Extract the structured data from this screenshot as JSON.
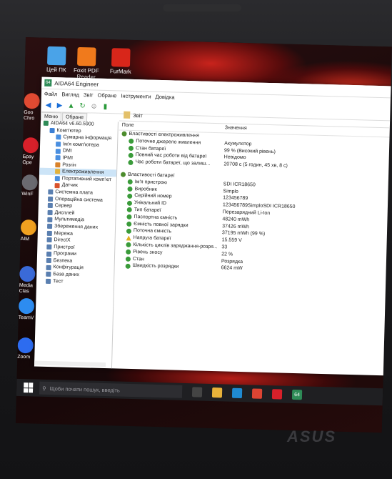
{
  "desktop_icons": [
    {
      "label": "Цей ПК",
      "icon": "computer-icon",
      "color": "#4aa3e8"
    },
    {
      "label": "Foxit PDF Reader",
      "icon": "foxit-pdf-icon",
      "color": "#f07a1c"
    },
    {
      "label": "FurMark",
      "icon": "furmark-icon",
      "color": "#d8261a"
    }
  ],
  "left_edge": [
    {
      "label": "Goo Chro",
      "icon": "chrome-icon"
    },
    {
      "label": "Брау Ope",
      "icon": "opera-icon"
    },
    {
      "label": "WinF",
      "icon": "winf-icon"
    },
    {
      "label": "AIM",
      "icon": "aimp-icon"
    },
    {
      "label": "Media Clas",
      "icon": "media-classic-icon"
    },
    {
      "label": "TeamV",
      "icon": "teamviewer-icon"
    },
    {
      "label": "Zoom",
      "icon": "zoom-icon"
    }
  ],
  "window": {
    "title": "AIDA64 Engineer",
    "menu": [
      "Файл",
      "Вигляд",
      "Звіт",
      "Обране",
      "Інструменти",
      "Довідка"
    ],
    "tabs": [
      "Меню",
      "Обране"
    ],
    "report_button": "Звіт",
    "tree": [
      {
        "label": "AIDA64 v6.60.5900",
        "indent": 0
      },
      {
        "label": "Комп'ютер",
        "indent": 1
      },
      {
        "label": "Сумарна інформація",
        "indent": 2
      },
      {
        "label": "Ім'я комп'ютера",
        "indent": 2
      },
      {
        "label": "DMI",
        "indent": 2
      },
      {
        "label": "IPMI",
        "indent": 2
      },
      {
        "label": "Розгін",
        "indent": 2
      },
      {
        "label": "Електроживлення",
        "indent": 2,
        "selected": true
      },
      {
        "label": "Портативний комп'ют",
        "indent": 2
      },
      {
        "label": "Датчик",
        "indent": 2
      },
      {
        "label": "Системна плата",
        "indent": 1
      },
      {
        "label": "Операційна система",
        "indent": 1
      },
      {
        "label": "Сервер",
        "indent": 1
      },
      {
        "label": "Дисплей",
        "indent": 1
      },
      {
        "label": "Мультимедіа",
        "indent": 1
      },
      {
        "label": "Збереження даних",
        "indent": 1
      },
      {
        "label": "Мережа",
        "indent": 1
      },
      {
        "label": "DirectX",
        "indent": 1
      },
      {
        "label": "Пристрої",
        "indent": 1
      },
      {
        "label": "Програми",
        "indent": 1
      },
      {
        "label": "Безпека",
        "indent": 1
      },
      {
        "label": "Конфігурація",
        "indent": 1
      },
      {
        "label": "База даних",
        "indent": 1
      },
      {
        "label": "Тест",
        "indent": 1
      }
    ],
    "columns": [
      "Поле",
      "Значення"
    ],
    "sections": [
      {
        "title": "Властивості електроживлення",
        "rows": [
          {
            "field": "Поточне джерело живлення",
            "value": "Акумулятор"
          },
          {
            "field": "Стан батареї",
            "value": "99 % (Високий рівень)"
          },
          {
            "field": "Повний час роботи від батареї",
            "value": "Невідомо"
          },
          {
            "field": "Час роботи батареї, що залиш...",
            "value": "20708 с (5 годин, 45 хв, 8 с)"
          }
        ]
      },
      {
        "title": "Властивості батареї",
        "rows": [
          {
            "field": "Ім'я пристрою",
            "value": "SDI ICR18650"
          },
          {
            "field": "Виробник",
            "value": "Simplo"
          },
          {
            "field": "Серійний номер",
            "value": "123456789"
          },
          {
            "field": "Унікальний ID",
            "value": "123456789SimploSDI ICR18650"
          },
          {
            "field": "Тип батареї",
            "value": "Перезарядний Li-Ion"
          },
          {
            "field": "Паспортна ємність",
            "value": "48240 mWh"
          },
          {
            "field": "Ємність повної зарядки",
            "value": "37426 mWh"
          },
          {
            "field": "Поточна ємність",
            "value": "37195 mWh  (99 %)"
          },
          {
            "field": "Напруга батареї",
            "value": "15.559 V",
            "warn": true
          },
          {
            "field": "Кількість циклів заряджання-розря...",
            "value": "33"
          },
          {
            "field": "Рівень зносу",
            "value": "22 %"
          },
          {
            "field": "Стан",
            "value": "Розрядка"
          },
          {
            "field": "Швидкість розрядки",
            "value": "6624 mW"
          }
        ]
      }
    ]
  },
  "taskbar": {
    "search_placeholder": "Щоби почати пошук, введіть",
    "icons": [
      {
        "name": "task-view-icon",
        "color": "#444"
      },
      {
        "name": "file-explorer-icon",
        "color": "#e8b23a"
      },
      {
        "name": "edge-icon",
        "color": "#1f8ad1"
      },
      {
        "name": "chrome-icon",
        "color": "#dd4433"
      },
      {
        "name": "opera-icon",
        "color": "#d8202a"
      },
      {
        "name": "aida64-icon",
        "color": "#2e8b57",
        "text": "64"
      }
    ]
  },
  "brand": "ASUS"
}
